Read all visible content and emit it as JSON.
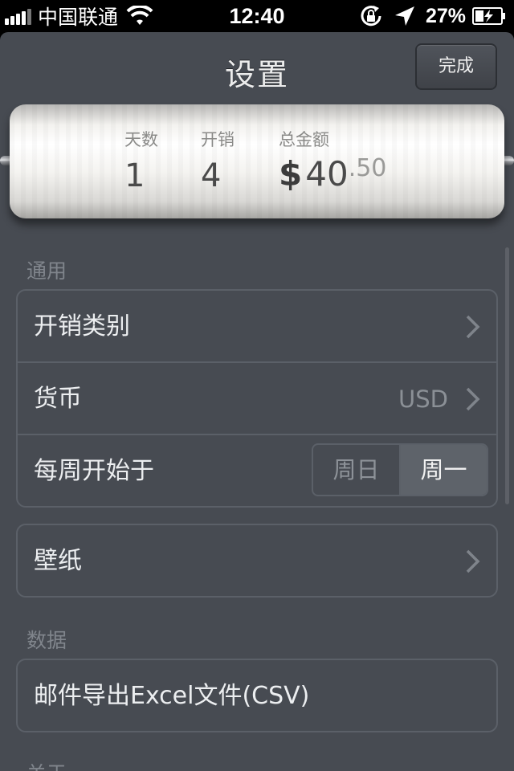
{
  "status_bar": {
    "carrier": "中国联通",
    "time": "12:40",
    "battery_percent": "27%"
  },
  "navbar": {
    "title": "设置",
    "done_label": "完成"
  },
  "summary": {
    "days_label": "天数",
    "days_value": "1",
    "expenses_label": "开销",
    "expenses_value": "4",
    "total_label": "总金额",
    "currency_symbol": "$",
    "total_integer": "40",
    "total_decimal": ".50"
  },
  "sections": {
    "general_header": "通用",
    "category_label": "开销类别",
    "currency_label": "货币",
    "currency_value": "USD",
    "week_start_label": "每周开始于",
    "week_options": [
      "周日",
      "周一"
    ],
    "week_selected": "周一",
    "wallpaper_label": "壁纸",
    "data_header": "数据",
    "export_label": "邮件导出Excel文件(CSV)",
    "about_header_partial": "关于"
  },
  "colors": {
    "panel_bg": "#474b52",
    "border": "#5b6068",
    "selected_segment": "#5e636a"
  }
}
